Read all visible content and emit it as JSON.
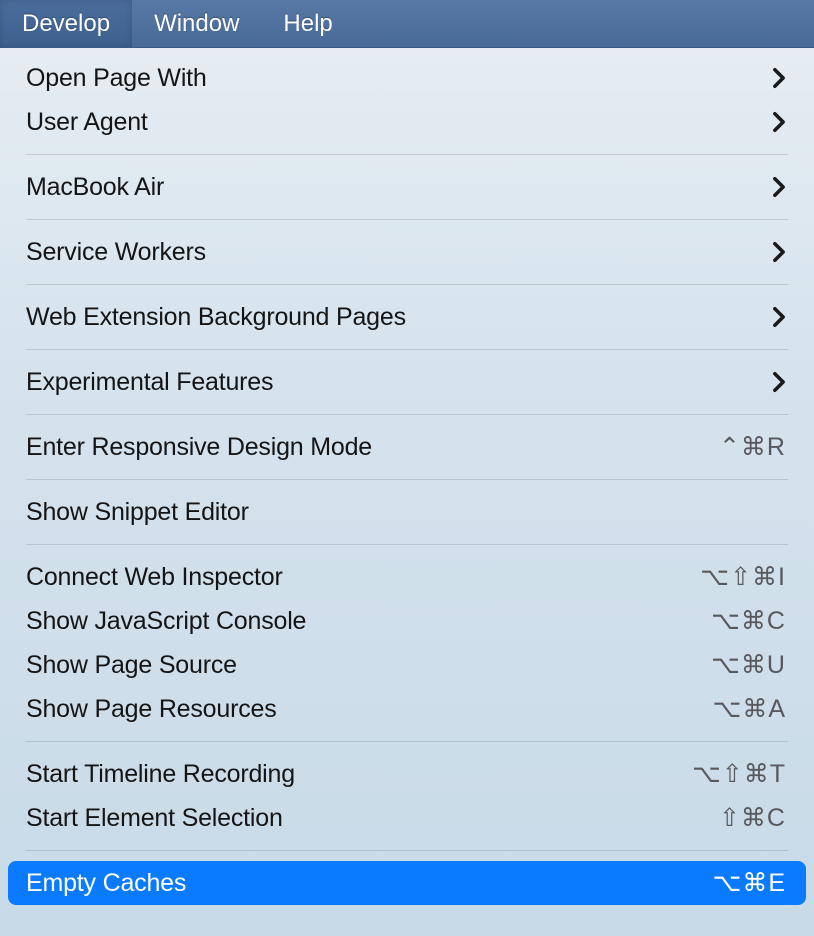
{
  "menubar": {
    "items": [
      {
        "label": "Develop",
        "active": true
      },
      {
        "label": "Window",
        "active": false
      },
      {
        "label": "Help",
        "active": false
      }
    ]
  },
  "menu": {
    "groups": [
      [
        {
          "id": "open-page-with",
          "label": "Open Page With",
          "submenu": true,
          "shortcut": ""
        },
        {
          "id": "user-agent",
          "label": "User Agent",
          "submenu": true,
          "shortcut": ""
        }
      ],
      [
        {
          "id": "macbook-air",
          "label": "MacBook Air",
          "submenu": true,
          "shortcut": ""
        }
      ],
      [
        {
          "id": "service-workers",
          "label": "Service Workers",
          "submenu": true,
          "shortcut": ""
        }
      ],
      [
        {
          "id": "web-extension-background-pages",
          "label": "Web Extension Background Pages",
          "submenu": true,
          "shortcut": ""
        }
      ],
      [
        {
          "id": "experimental-features",
          "label": "Experimental Features",
          "submenu": true,
          "shortcut": ""
        }
      ],
      [
        {
          "id": "enter-responsive-design-mode",
          "label": "Enter Responsive Design Mode",
          "submenu": false,
          "shortcut": "⌃⌘R"
        }
      ],
      [
        {
          "id": "show-snippet-editor",
          "label": "Show Snippet Editor",
          "submenu": false,
          "shortcut": ""
        }
      ],
      [
        {
          "id": "connect-web-inspector",
          "label": "Connect Web Inspector",
          "submenu": false,
          "shortcut": "⌥⇧⌘I"
        },
        {
          "id": "show-javascript-console",
          "label": "Show JavaScript Console",
          "submenu": false,
          "shortcut": "⌥⌘C"
        },
        {
          "id": "show-page-source",
          "label": "Show Page Source",
          "submenu": false,
          "shortcut": "⌥⌘U"
        },
        {
          "id": "show-page-resources",
          "label": "Show Page Resources",
          "submenu": false,
          "shortcut": "⌥⌘A"
        }
      ],
      [
        {
          "id": "start-timeline-recording",
          "label": "Start Timeline Recording",
          "submenu": false,
          "shortcut": "⌥⇧⌘T"
        },
        {
          "id": "start-element-selection",
          "label": "Start Element Selection",
          "submenu": false,
          "shortcut": "⇧⌘C"
        }
      ],
      [
        {
          "id": "empty-caches",
          "label": "Empty Caches",
          "submenu": false,
          "shortcut": "⌥⌘E",
          "highlighted": true
        }
      ]
    ]
  }
}
